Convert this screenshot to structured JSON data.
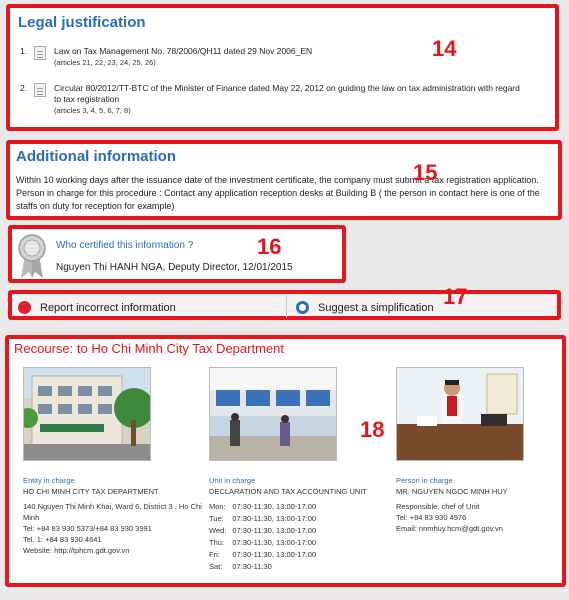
{
  "annotations": [
    "14",
    "15",
    "16",
    "17",
    "18"
  ],
  "legal": {
    "title": "Legal justification",
    "items": [
      {
        "num": "1.",
        "text": "Law on Tax Management No. 78/2006/QH11 dated 29 Nov 2006_EN",
        "articles": "(articles 21, 22, 23, 24, 25, 26)"
      },
      {
        "num": "2.",
        "text": "Circular 80/2012/TT-BTC of the Minister of Finance dated May 22, 2012 on guiding the law on tax administration with regard to tax registration",
        "articles": "(articles 3, 4, 5, 6, 7, 8)"
      }
    ]
  },
  "additional": {
    "title": "Additional information",
    "body": "Within 10 working days after the issuance date of the investment certificate, the company must submit a tax registration application. Person in charge for this procedure : Contact any application reception desks at Building B ( the person in contact here is one of the staffs on duty for reception for example)"
  },
  "certified": {
    "question": "Who certified this information ?",
    "person": "Nguyen Thi HANH NGA, Deputy Director, 12/01/2015"
  },
  "actions": {
    "report": "Report incorrect information",
    "suggest": "Suggest a simplification"
  },
  "recourse": {
    "title": "Recourse: to Ho Chi Minh City Tax Department",
    "entity": {
      "role": "Entity in charge",
      "name": "HO CHI MINH CITY TAX DEPARTMENT",
      "address": "140 Nguyen Thi Minh Khai, Ward 6, District 3 , Ho Chi Minh",
      "tel": "Tel: +84 83 930 5373/+84 83 930 3991",
      "tel1": "Tel. 1: +84 83 930 4641",
      "website": "Website: http://tphcm.gdt.gov.vn"
    },
    "unit": {
      "role": "Unit in charge",
      "name": "DECLARATION AND TAX ACCOUNTING UNIT",
      "hours": [
        {
          "day": "Mon:",
          "time": "07:30-11:30, 13:00-17:00"
        },
        {
          "day": "Tue:",
          "time": "07:30-11:30, 13:00-17:00"
        },
        {
          "day": "Wed:",
          "time": "07:30-11:30, 13:00-17:00"
        },
        {
          "day": "Thu:",
          "time": "07:30-11:30, 13:00-17:00"
        },
        {
          "day": "Fri:",
          "time": "07:30-11:30, 13:00-17:00"
        },
        {
          "day": "Sat:",
          "time": "07:30-11:30"
        }
      ]
    },
    "person": {
      "role": "Person in charge",
      "name": "MR. NGUYEN NGOC MINH HUY",
      "position": "Responsible, chef of Unit",
      "tel": "Tel: +84 83 930 4976",
      "email": "Email: nnmhuy.hcm@gdt.gov.vn"
    }
  },
  "colors": {
    "frame": "#e8141b",
    "link": "#2a6db5",
    "report_icon": "#d9232d",
    "suggest_icon": "#2a6db5"
  }
}
